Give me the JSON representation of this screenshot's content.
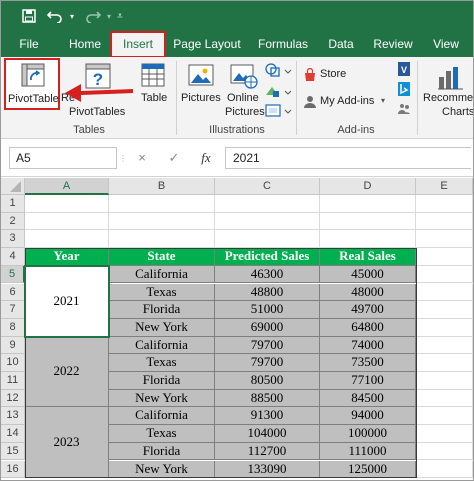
{
  "quick_access": {
    "save_icon": "save-icon",
    "undo_icon": "undo-icon",
    "redo_icon": "redo-icon",
    "customize_icon": "customize-qat-icon"
  },
  "tabs": [
    "File",
    "Home",
    "Insert",
    "Page Layout",
    "Formulas",
    "Data",
    "Review",
    "View"
  ],
  "active_tab": "Insert",
  "ribbon": {
    "pivottable": "PivotTable",
    "recommended_partial": "Re",
    "recommended_line2": "PivotTables",
    "table": "Table",
    "tables_group": "Tables",
    "pictures": "Pictures",
    "online_pictures_1": "Online",
    "online_pictures_2": "Pictures",
    "illustrations_group": "Illustrations",
    "store": "Store",
    "my_addins": "My Add-ins",
    "addins_group": "Add-ins",
    "recommended_charts_1": "Recommen",
    "recommended_charts_2": "Charts"
  },
  "formula_bar": {
    "name_box": "A5",
    "cancel_symbol": "×",
    "enter_symbol": "✓",
    "fx_symbol": "fx",
    "value": "2021"
  },
  "columns": [
    "A",
    "B",
    "C",
    "D",
    "E"
  ],
  "rows": [
    "1",
    "2",
    "3",
    "4",
    "5",
    "6",
    "7",
    "8",
    "9",
    "10",
    "11",
    "12",
    "13",
    "14",
    "15",
    "16"
  ],
  "selected_cell": {
    "column": "A",
    "row": "5"
  },
  "table": {
    "headers": [
      "Year",
      "State",
      "Predicted Sales",
      "Real Sales"
    ],
    "groups": [
      {
        "year": "2021",
        "rows": [
          [
            "California",
            "46300",
            "45000"
          ],
          [
            "Texas",
            "48800",
            "48000"
          ],
          [
            "Florida",
            "51000",
            "49700"
          ],
          [
            "New York",
            "69000",
            "64800"
          ]
        ]
      },
      {
        "year": "2022",
        "rows": [
          [
            "California",
            "79700",
            "74000"
          ],
          [
            "Texas",
            "79700",
            "73500"
          ],
          [
            "Florida",
            "80500",
            "77100"
          ],
          [
            "New York",
            "88500",
            "84500"
          ]
        ]
      },
      {
        "year": "2023",
        "rows": [
          [
            "California",
            "91300",
            "94000"
          ],
          [
            "Texas",
            "104000",
            "100000"
          ],
          [
            "Florida",
            "112700",
            "111000"
          ],
          [
            "New York",
            "133090",
            "125000"
          ]
        ]
      }
    ]
  },
  "colors": {
    "excel_green": "#217346",
    "header_fill": "#00b050",
    "row_fill_gray": "#bfbfbf",
    "highlight_red": "#d62020"
  }
}
